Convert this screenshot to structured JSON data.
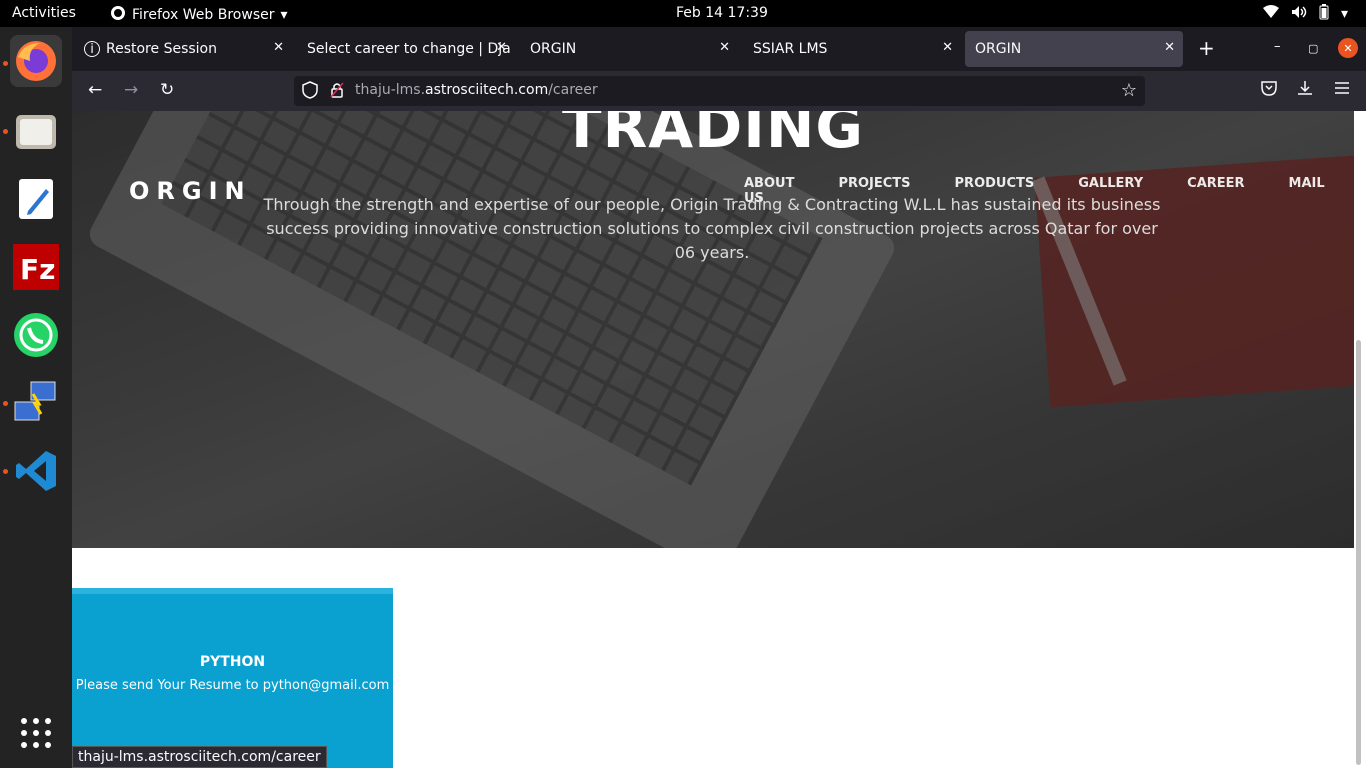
{
  "topbar": {
    "activities": "Activities",
    "app_name": "Firefox Web Browser",
    "clock": "Feb 14  17:39"
  },
  "dock": {
    "items": [
      "firefox",
      "files",
      "text-editor",
      "filezilla",
      "whatsapp",
      "remote-desktop",
      "vscode"
    ]
  },
  "browser": {
    "tabs": [
      {
        "label": "Restore Session"
      },
      {
        "label": "Select career to change | Dja"
      },
      {
        "label": "ORGIN"
      },
      {
        "label": "SSIAR LMS"
      },
      {
        "label": "ORGIN"
      }
    ],
    "url_prefix": "thaju-lms.",
    "url_domain": "astrosciitech.com",
    "url_path": "/career"
  },
  "page": {
    "hero_title": "TRADING",
    "brand": "ORGIN",
    "menu": [
      "ABOUT US",
      "PROJECTS",
      "PRODUCTS",
      "GALLERY",
      "CAREER",
      "MAIL"
    ],
    "hero_text": "Through the strength and expertise of our people, Origin Trading & Contracting W.L.L has sustained its business success providing innovative construction solutions to complex civil construction projects across Qatar for over 06 years.",
    "card_title": "PYTHON",
    "card_text": "Please send Your Resume to python@gmail.com"
  },
  "status_link": "thaju-lms.astrosciitech.com/career",
  "colors": {
    "accent": "#e95420",
    "card": "#0aa0cf"
  }
}
